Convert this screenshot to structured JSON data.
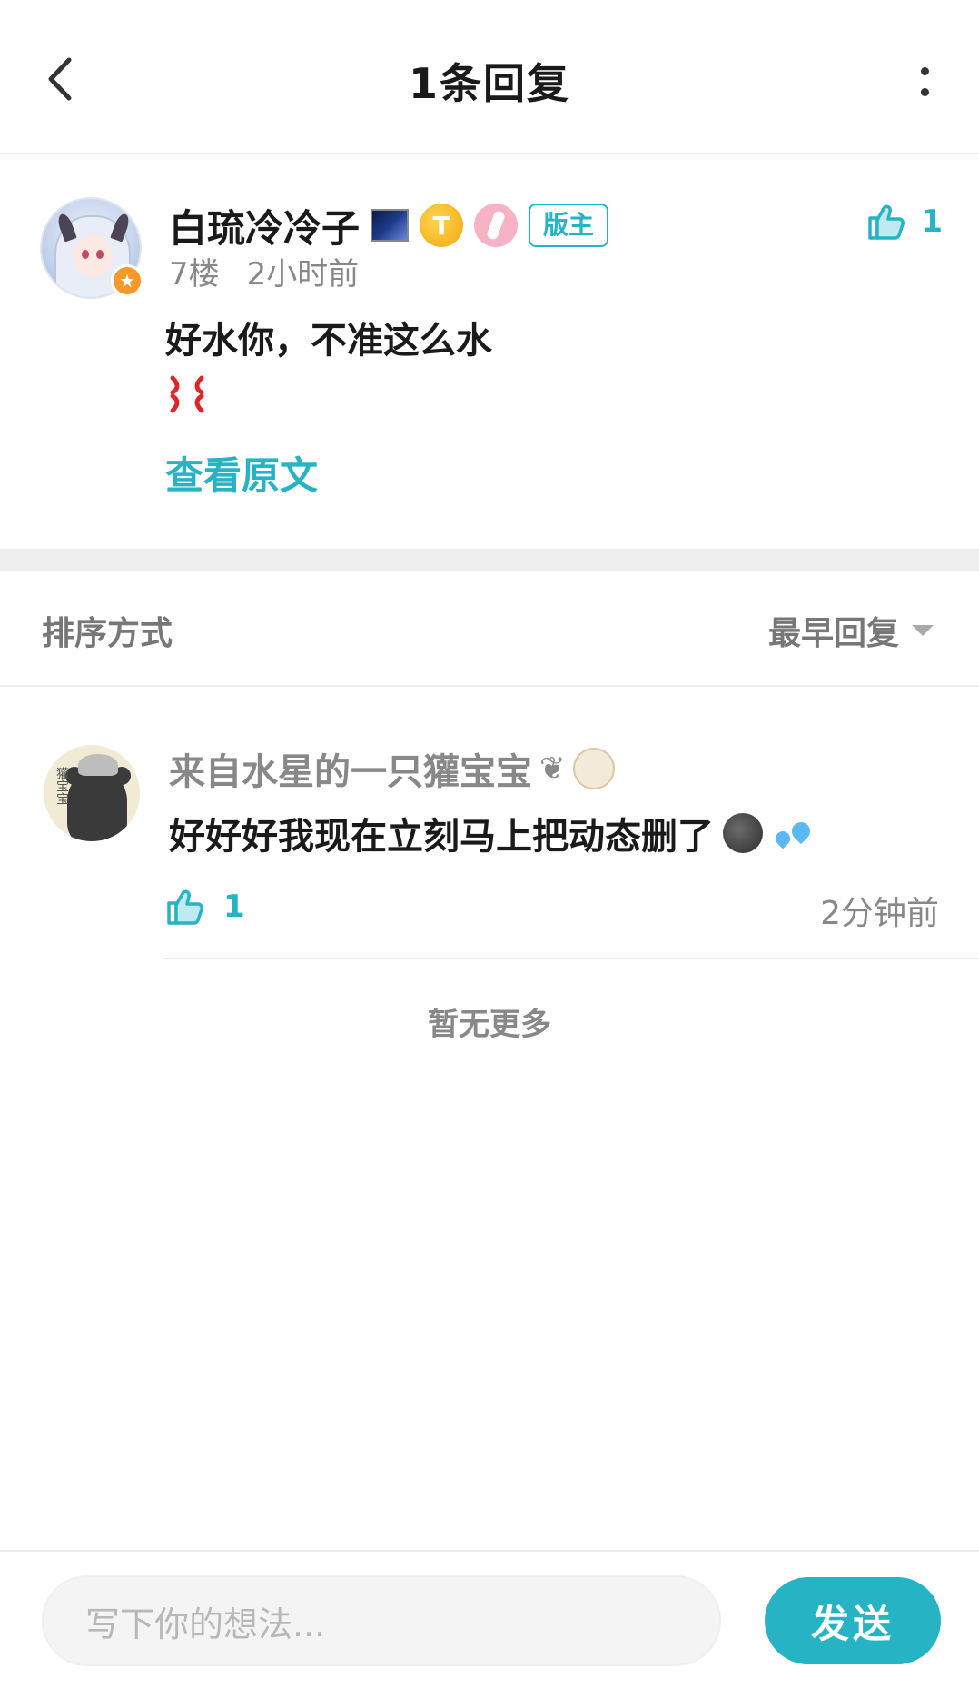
{
  "header": {
    "title": "1条回复"
  },
  "main_comment": {
    "username": "白琉冷冷子",
    "moderator_badge": "版主",
    "floor": "7楼",
    "time": "2小时前",
    "text": "好水你，不准这么水",
    "view_original": "查看原文",
    "like_count": "1",
    "avatar_badge_icon": "star-icon"
  },
  "sort": {
    "label": "排序方式",
    "value": "最早回复"
  },
  "reply": {
    "username": "来自水星的一只獾宝宝",
    "name_deco": "❦",
    "avatar_text": "獾宝宝",
    "text": "好好好我现在立刻马上把动态删了",
    "like_count": "1",
    "time": "2分钟前"
  },
  "footer": {
    "no_more": "暂无更多",
    "input_placeholder": "写下你的想法...",
    "send_label": "发送"
  },
  "colors": {
    "accent": "#26b4c4",
    "muted": "#888888",
    "badge_orange": "#f59a2a"
  }
}
